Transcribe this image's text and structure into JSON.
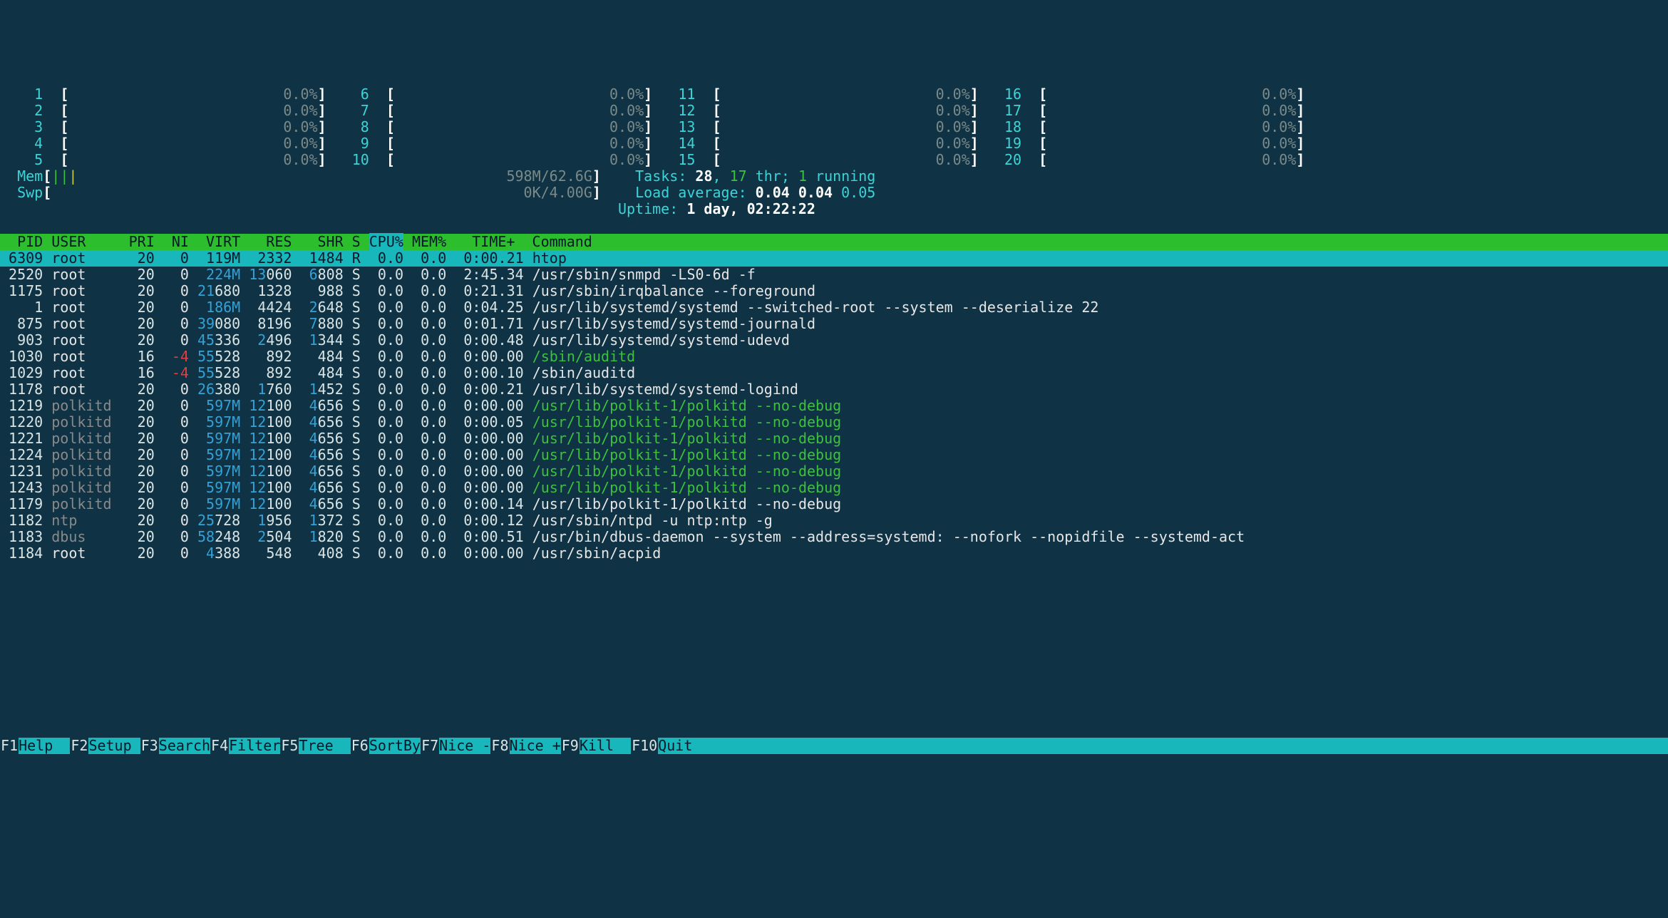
{
  "cpu_bars": [
    {
      "n": "1",
      "pct": "0.0%"
    },
    {
      "n": "2",
      "pct": "0.0%"
    },
    {
      "n": "3",
      "pct": "0.0%"
    },
    {
      "n": "4",
      "pct": "0.0%"
    },
    {
      "n": "5",
      "pct": "0.0%"
    },
    {
      "n": "6",
      "pct": "0.0%"
    },
    {
      "n": "7",
      "pct": "0.0%"
    },
    {
      "n": "8",
      "pct": "0.0%"
    },
    {
      "n": "9",
      "pct": "0.0%"
    },
    {
      "n": "10",
      "pct": "0.0%"
    },
    {
      "n": "11",
      "pct": "0.0%"
    },
    {
      "n": "12",
      "pct": "0.0%"
    },
    {
      "n": "13",
      "pct": "0.0%"
    },
    {
      "n": "14",
      "pct": "0.0%"
    },
    {
      "n": "15",
      "pct": "0.0%"
    },
    {
      "n": "16",
      "pct": "0.0%"
    },
    {
      "n": "17",
      "pct": "0.0%"
    },
    {
      "n": "18",
      "pct": "0.0%"
    },
    {
      "n": "19",
      "pct": "0.0%"
    },
    {
      "n": "20",
      "pct": "0.0%"
    }
  ],
  "mem": {
    "label": "Mem",
    "bar": "|||",
    "used": "598M",
    "total": "62.6G"
  },
  "swp": {
    "label": "Swp",
    "used": "0K",
    "total": "4.00G"
  },
  "tasks": {
    "label": "Tasks:",
    "count": "28",
    "thr": "17",
    "thr_label": "thr;",
    "running": "1",
    "run_label": "running"
  },
  "load": {
    "label": "Load average:",
    "l1": "0.04",
    "l2": "0.04",
    "l3": "0.05"
  },
  "uptime": {
    "label": "Uptime:",
    "val": "1 day, 02:22:22"
  },
  "headers": [
    "  PID",
    "USER    ",
    "PRI",
    " NI",
    " VIRT",
    "  RES",
    "  SHR",
    "S",
    "CPU%",
    "MEM%",
    "  TIME+ ",
    "Command"
  ],
  "rows": [
    {
      "pid": "6309",
      "user": "root",
      "pri": "20",
      "ni": "0",
      "virt": {
        "a": "",
        "b": "119M"
      },
      "res": {
        "a": "",
        "b": "2332"
      },
      "shr": {
        "a": "",
        "b": "1484"
      },
      "s": "R",
      "cpu": "0.0",
      "mem": "0.0",
      "time": "0:00.21",
      "cmd": "htop",
      "style": "cmd-white",
      "cursor": true
    },
    {
      "pid": "2520",
      "user": "root",
      "pri": "20",
      "ni": "0",
      "virt": {
        "a": "",
        "b": "224M",
        "bblue": true
      },
      "res": {
        "a": "13",
        "b": "060"
      },
      "shr": {
        "a": "6",
        "b": "808"
      },
      "s": "S",
      "cpu": "0.0",
      "mem": "0.0",
      "time": "2:45.34",
      "cmd": "/usr/sbin/snmpd -LS0-6d -f",
      "style": "cmd-white"
    },
    {
      "pid": "1175",
      "user": "root",
      "pri": "20",
      "ni": "0",
      "virt": {
        "a": "21",
        "b": "680"
      },
      "res": {
        "a": "",
        "b": "1328"
      },
      "shr": {
        "a": "",
        "b": "988"
      },
      "s": "S",
      "cpu": "0.0",
      "mem": "0.0",
      "time": "0:21.31",
      "cmd": "/usr/sbin/irqbalance --foreground",
      "style": "cmd-white"
    },
    {
      "pid": "1",
      "user": "root",
      "pri": "20",
      "ni": "0",
      "virt": {
        "a": "",
        "b": "186M",
        "bblue": true
      },
      "res": {
        "a": "",
        "b": "4424"
      },
      "shr": {
        "a": "2",
        "b": "648"
      },
      "s": "S",
      "cpu": "0.0",
      "mem": "0.0",
      "time": "0:04.25",
      "cmd": "/usr/lib/systemd/systemd --switched-root --system --deserialize 22",
      "style": "cmd-white"
    },
    {
      "pid": "875",
      "user": "root",
      "pri": "20",
      "ni": "0",
      "virt": {
        "a": "39",
        "b": "080"
      },
      "res": {
        "a": "",
        "b": "8196"
      },
      "shr": {
        "a": "7",
        "b": "880"
      },
      "s": "S",
      "cpu": "0.0",
      "mem": "0.0",
      "time": "0:01.71",
      "cmd": "/usr/lib/systemd/systemd-journald",
      "style": "cmd-white"
    },
    {
      "pid": "903",
      "user": "root",
      "pri": "20",
      "ni": "0",
      "virt": {
        "a": "45",
        "b": "336"
      },
      "res": {
        "a": "2",
        "b": "496"
      },
      "shr": {
        "a": "1",
        "b": "344"
      },
      "s": "S",
      "cpu": "0.0",
      "mem": "0.0",
      "time": "0:00.48",
      "cmd": "/usr/lib/systemd/systemd-udevd",
      "style": "cmd-white"
    },
    {
      "pid": "1030",
      "user": "root",
      "pri": "16",
      "ni": "-4",
      "nired": true,
      "virt": {
        "a": "55",
        "b": "528"
      },
      "res": {
        "a": "",
        "b": "892"
      },
      "shr": {
        "a": "",
        "b": "484"
      },
      "s": "S",
      "cpu": "0.0",
      "mem": "0.0",
      "time": "0:00.00",
      "cmd": "/sbin/auditd",
      "style": "cmd-green"
    },
    {
      "pid": "1029",
      "user": "root",
      "pri": "16",
      "ni": "-4",
      "nired": true,
      "virt": {
        "a": "55",
        "b": "528"
      },
      "res": {
        "a": "",
        "b": "892"
      },
      "shr": {
        "a": "",
        "b": "484"
      },
      "s": "S",
      "cpu": "0.0",
      "mem": "0.0",
      "time": "0:00.10",
      "cmd": "/sbin/auditd",
      "style": "cmd-white"
    },
    {
      "pid": "1178",
      "user": "root",
      "pri": "20",
      "ni": "0",
      "virt": {
        "a": "26",
        "b": "380"
      },
      "res": {
        "a": "1",
        "b": "760"
      },
      "shr": {
        "a": "1",
        "b": "452"
      },
      "s": "S",
      "cpu": "0.0",
      "mem": "0.0",
      "time": "0:00.21",
      "cmd": "/usr/lib/systemd/systemd-logind",
      "style": "cmd-white"
    },
    {
      "pid": "1219",
      "user": "polkitd",
      "pri": "20",
      "ni": "0",
      "virt": {
        "a": "",
        "b": "597M",
        "bblue": true
      },
      "res": {
        "a": "12",
        "b": "100"
      },
      "shr": {
        "a": "4",
        "b": "656"
      },
      "s": "S",
      "cpu": "0.0",
      "mem": "0.0",
      "time": "0:00.00",
      "cmd": "/usr/lib/polkit-1/polkitd --no-debug",
      "style": "cmd-green"
    },
    {
      "pid": "1220",
      "user": "polkitd",
      "pri": "20",
      "ni": "0",
      "virt": {
        "a": "",
        "b": "597M",
        "bblue": true
      },
      "res": {
        "a": "12",
        "b": "100"
      },
      "shr": {
        "a": "4",
        "b": "656"
      },
      "s": "S",
      "cpu": "0.0",
      "mem": "0.0",
      "time": "0:00.05",
      "cmd": "/usr/lib/polkit-1/polkitd --no-debug",
      "style": "cmd-green"
    },
    {
      "pid": "1221",
      "user": "polkitd",
      "pri": "20",
      "ni": "0",
      "virt": {
        "a": "",
        "b": "597M",
        "bblue": true
      },
      "res": {
        "a": "12",
        "b": "100"
      },
      "shr": {
        "a": "4",
        "b": "656"
      },
      "s": "S",
      "cpu": "0.0",
      "mem": "0.0",
      "time": "0:00.00",
      "cmd": "/usr/lib/polkit-1/polkitd --no-debug",
      "style": "cmd-green"
    },
    {
      "pid": "1224",
      "user": "polkitd",
      "pri": "20",
      "ni": "0",
      "virt": {
        "a": "",
        "b": "597M",
        "bblue": true
      },
      "res": {
        "a": "12",
        "b": "100"
      },
      "shr": {
        "a": "4",
        "b": "656"
      },
      "s": "S",
      "cpu": "0.0",
      "mem": "0.0",
      "time": "0:00.00",
      "cmd": "/usr/lib/polkit-1/polkitd --no-debug",
      "style": "cmd-green"
    },
    {
      "pid": "1231",
      "user": "polkitd",
      "pri": "20",
      "ni": "0",
      "virt": {
        "a": "",
        "b": "597M",
        "bblue": true
      },
      "res": {
        "a": "12",
        "b": "100"
      },
      "shr": {
        "a": "4",
        "b": "656"
      },
      "s": "S",
      "cpu": "0.0",
      "mem": "0.0",
      "time": "0:00.00",
      "cmd": "/usr/lib/polkit-1/polkitd --no-debug",
      "style": "cmd-green"
    },
    {
      "pid": "1243",
      "user": "polkitd",
      "pri": "20",
      "ni": "0",
      "virt": {
        "a": "",
        "b": "597M",
        "bblue": true
      },
      "res": {
        "a": "12",
        "b": "100"
      },
      "shr": {
        "a": "4",
        "b": "656"
      },
      "s": "S",
      "cpu": "0.0",
      "mem": "0.0",
      "time": "0:00.00",
      "cmd": "/usr/lib/polkit-1/polkitd --no-debug",
      "style": "cmd-green"
    },
    {
      "pid": "1179",
      "user": "polkitd",
      "pri": "20",
      "ni": "0",
      "virt": {
        "a": "",
        "b": "597M",
        "bblue": true
      },
      "res": {
        "a": "12",
        "b": "100"
      },
      "shr": {
        "a": "4",
        "b": "656"
      },
      "s": "S",
      "cpu": "0.0",
      "mem": "0.0",
      "time": "0:00.14",
      "cmd": "/usr/lib/polkit-1/polkitd --no-debug",
      "style": "cmd-white"
    },
    {
      "pid": "1182",
      "user": "ntp",
      "pri": "20",
      "ni": "0",
      "virt": {
        "a": "25",
        "b": "728"
      },
      "res": {
        "a": "1",
        "b": "956"
      },
      "shr": {
        "a": "1",
        "b": "372"
      },
      "s": "S",
      "cpu": "0.0",
      "mem": "0.0",
      "time": "0:00.12",
      "cmd": "/usr/sbin/ntpd -u ntp:ntp -g",
      "style": "cmd-white"
    },
    {
      "pid": "1183",
      "user": "dbus",
      "pri": "20",
      "ni": "0",
      "virt": {
        "a": "58",
        "b": "248"
      },
      "res": {
        "a": "2",
        "b": "504"
      },
      "shr": {
        "a": "1",
        "b": "820"
      },
      "s": "S",
      "cpu": "0.0",
      "mem": "0.0",
      "time": "0:00.51",
      "cmd": "/usr/bin/dbus-daemon --system --address=systemd: --nofork --nopidfile --systemd-act",
      "style": "cmd-white"
    },
    {
      "pid": "1184",
      "user": "root",
      "pri": "20",
      "ni": "0",
      "virt": {
        "a": "4",
        "b": "388"
      },
      "res": {
        "a": "",
        "b": "548"
      },
      "shr": {
        "a": "",
        "b": "408"
      },
      "s": "S",
      "cpu": "0.0",
      "mem": "0.0",
      "time": "0:00.00",
      "cmd": "/usr/sbin/acpid",
      "style": "cmd-white"
    }
  ],
  "footer": [
    {
      "k": "F1",
      "l": "Help  "
    },
    {
      "k": "F2",
      "l": "Setup "
    },
    {
      "k": "F3",
      "l": "Search"
    },
    {
      "k": "F4",
      "l": "Filter"
    },
    {
      "k": "F5",
      "l": "Tree  "
    },
    {
      "k": "F6",
      "l": "SortBy"
    },
    {
      "k": "F7",
      "l": "Nice -"
    },
    {
      "k": "F8",
      "l": "Nice +"
    },
    {
      "k": "F9",
      "l": "Kill  "
    },
    {
      "k": "F10",
      "l": "Quit  "
    }
  ]
}
